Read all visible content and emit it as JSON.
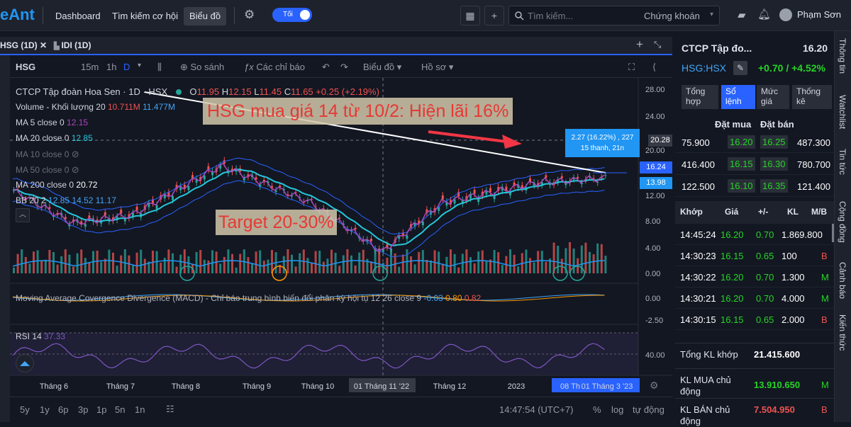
{
  "app": {
    "logo": "eAnt",
    "nav": [
      "Dashboard",
      "Tìm kiếm cơ hội",
      "Biểu đồ"
    ],
    "theme_toggle": "Tối",
    "search_placeholder": "Tìm kiếm...",
    "search_scope": "Chứng khoán",
    "user": "Phạm Sơn"
  },
  "tabs": [
    "HSG (1D)",
    "IDI (1D)"
  ],
  "toolbar": {
    "symbol": "HSG",
    "intervals": [
      "15m",
      "1h",
      "D"
    ],
    "compare": "So sánh",
    "indicators": "Các chỉ báo",
    "chart_type": "Biểu đồ",
    "profile": "Hồ sơ"
  },
  "legend": {
    "title": "CTCP Tập đoàn Hoa Sen · 1D · HSX",
    "o": "O",
    "o_val": "11.95",
    "h": "H",
    "h_val": "12.15",
    "l": "L",
    "l_val": "11.45",
    "c": "C",
    "c_val": "11.65",
    "chg": "+0.25 (+2.19%)",
    "volume": "Volume - Khối lượng 20",
    "vol1": "10.711M",
    "vol2": "11.477M",
    "ma5": "MA 5 close 0",
    "ma5_val": "12.15",
    "ma20": "MA 20 close 0",
    "ma20_val": "12.85",
    "ma10": "MA 10 close 0",
    "ma50": "MA 50 close 0",
    "ma200": "MA 200 close 0",
    "ma200_val": "20.72",
    "bb": "BB 20 2",
    "bb1": "12.85",
    "bb2": "14.52",
    "bb3": "11.17",
    "macd": "Moving Average Covergence Divergence (MACD) - Chỉ báo trung bình biến đổi phân kỳ hội tụ 12 26 close 9",
    "macd1": "-0.03",
    "macd2": "0.80",
    "macd3": "0.82",
    "rsi": "RSI 14",
    "rsi_val": "37.33"
  },
  "annotations": {
    "headline": "HSG mua giá 14 từ 10/2: Hiện lãi 16%",
    "target": "Target 20-30%",
    "tooltip1": "2.27 (16.22%) , 227",
    "tooltip2": "15 thanh, 21n"
  },
  "price_axis": [
    "28.00",
    "24.00",
    "20.00",
    "16.00",
    "12.00",
    "8.00",
    "4.00",
    "0.00",
    "0.00",
    "-2.50",
    "40.00"
  ],
  "price_tags": {
    "p1": "20.28",
    "p2": "16.24",
    "p3": "13.98"
  },
  "colors": {
    "bg": "#131722",
    "up": "#26a69a",
    "down": "#ef5350",
    "accent": "#2962ff",
    "ma": "#26c6da",
    "white_line": "#ffffff"
  },
  "time_axis": [
    "Tháng 6",
    "Tháng 7",
    "Tháng 8",
    "Tháng 9",
    "Tháng 10",
    "01 Tháng 11 '22",
    "Tháng 12",
    "2023",
    "08 Th",
    "01 Tháng 3 '23"
  ],
  "bottom": {
    "ranges": [
      "5y",
      "1y",
      "6p",
      "3p",
      "1p",
      "5n",
      "1n"
    ],
    "time": "14:47:54 (UTC+7)",
    "pct": "%",
    "log": "log",
    "auto": "tự động"
  },
  "right_panel": {
    "company": "CTCP Tập đo...",
    "price": "16.20",
    "ticker": "HSG:HSX",
    "change": "+0.70 / +4.52%",
    "tabs": [
      "Tổng hợp",
      "Sổ lệnh",
      "Mức giá",
      "Thống kê"
    ],
    "book_headers": [
      "Đặt mua",
      "Đặt bán"
    ],
    "book": [
      [
        "75.900",
        "16.20",
        "16.25",
        "487.300"
      ],
      [
        "416.400",
        "16.15",
        "16.30",
        "780.700"
      ],
      [
        "122.500",
        "16.10",
        "16.35",
        "121.400"
      ]
    ],
    "trade_headers": [
      "Khớp",
      "Giá",
      "+/-",
      "KL",
      "M/B"
    ],
    "trades": [
      [
        "14:45:24",
        "16.20",
        "0.70",
        "1.869.800",
        ""
      ],
      [
        "14:30:23",
        "16.15",
        "0.65",
        "100",
        "B"
      ],
      [
        "14:30:22",
        "16.20",
        "0.70",
        "1.300",
        "M"
      ],
      [
        "14:30:21",
        "16.20",
        "0.70",
        "4.000",
        "M"
      ],
      [
        "14:30:15",
        "16.15",
        "0.65",
        "2.000",
        "B"
      ]
    ],
    "totals": [
      {
        "label": "Tổng KL khớp",
        "value": "21.415.600",
        "side": ""
      },
      {
        "label": "KL MUA chủ động",
        "value": "13.910.650",
        "side": "M"
      },
      {
        "label": "KL BÁN chủ động",
        "value": "7.504.950",
        "side": "B"
      }
    ]
  },
  "side_tabs": [
    "Thông tin",
    "Watchlist",
    "Tin tức",
    "Cộng đồng",
    "Cảnh báo",
    "Kiến thức"
  ]
}
